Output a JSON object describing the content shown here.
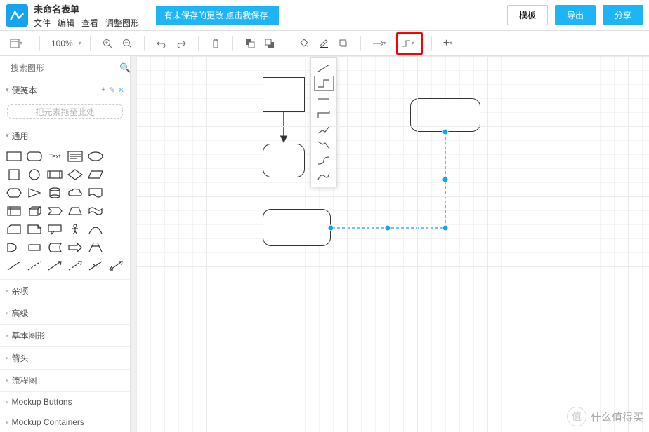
{
  "header": {
    "doc_title": "未命名表单",
    "menu": {
      "file": "文件",
      "edit": "编辑",
      "view": "查看",
      "adjust": "调整图形"
    },
    "unsaved_msg": "有未保存的更改.点击我保存.",
    "btn_template": "模板",
    "btn_export": "导出",
    "btn_share": "分享"
  },
  "toolbar": {
    "zoom": "100%"
  },
  "sidebar": {
    "search_placeholder": "搜索图形",
    "scratchpad": "便笺本",
    "dropzone": "把元素拖至此处",
    "section_common": "通用",
    "categories": [
      "杂项",
      "高级",
      "基本图形",
      "箭头",
      "流程图",
      "Mockup Buttons",
      "Mockup Containers"
    ]
  },
  "watermark": {
    "text": "什么值得买"
  }
}
